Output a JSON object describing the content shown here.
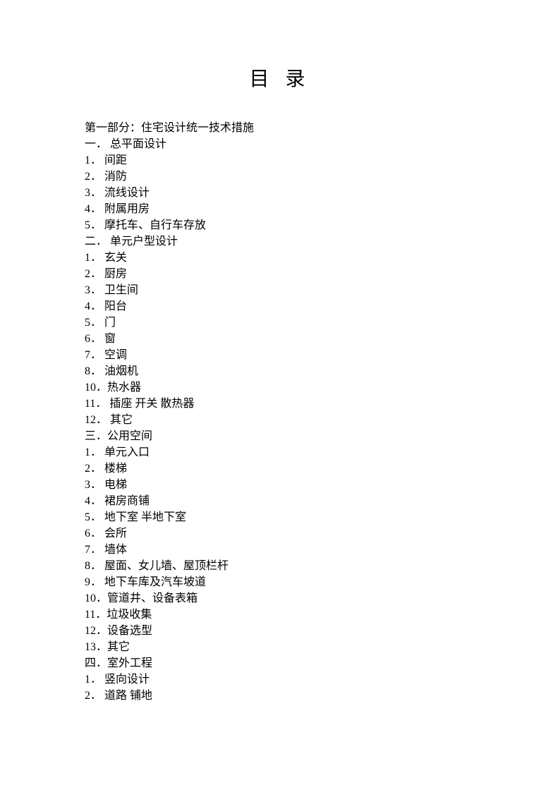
{
  "title": "目 录",
  "lines": [
    "第一部分：住宅设计统一技术措施",
    "一． 总平面设计",
    "1． 间距",
    "2． 消防",
    "3． 流线设计",
    "4． 附属用房",
    "5． 摩托车、自行车存放",
    "二． 单元户型设计",
    "1． 玄关",
    "2． 厨房",
    "3． 卫生间",
    "4． 阳台",
    "5． 门",
    "6． 窗",
    "7． 空调",
    "8． 油烟机",
    "10．热水器",
    "11． 插座 开关 散热器",
    "12． 其它",
    "三．公用空间",
    "1． 单元入口",
    "2． 楼梯",
    "3． 电梯",
    "4． 裙房商铺",
    "5． 地下室 半地下室",
    "6． 会所",
    "7． 墙体",
    "8． 屋面、女儿墙、屋顶栏杆",
    "9． 地下车库及汽车坡道",
    "10．管道井、设备表箱",
    "11．垃圾收集",
    "12．设备选型",
    "13．其它",
    "四．室外工程",
    "1． 竖向设计",
    "2． 道路 铺地"
  ]
}
